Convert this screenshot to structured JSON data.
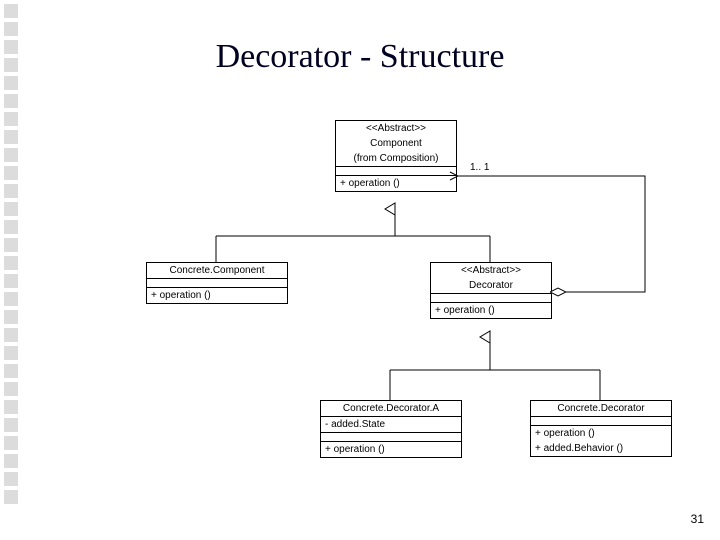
{
  "title": "Decorator - Structure",
  "page_number": "31",
  "multiplicity": "1.. 1",
  "component": {
    "stereotype": "<<Abstract>>",
    "name": "Component",
    "from": "(from Composition)",
    "op": "+ operation ()"
  },
  "concreteComponent": {
    "name": "Concrete.Component",
    "op": "+ operation ()"
  },
  "decorator": {
    "stereotype": "<<Abstract>>",
    "name": "Decorator",
    "op": "+ operation ()"
  },
  "concreteDecoratorA": {
    "name": "Concrete.Decorator.A",
    "attr": "- added.State",
    "op": "+ operation ()"
  },
  "concreteDecoratorB": {
    "name": "Concrete.Decorator",
    "op1": "+ operation ()",
    "op2": "+ added.Behavior ()"
  }
}
